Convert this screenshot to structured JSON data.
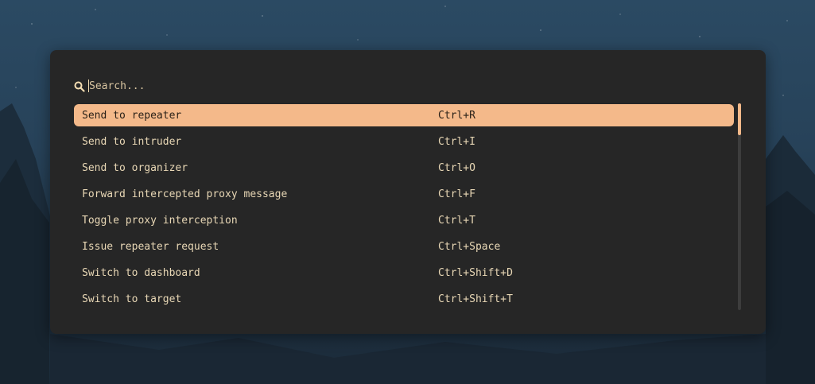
{
  "search": {
    "placeholder": "Search..."
  },
  "commands": [
    {
      "label": "Send to repeater",
      "shortcut": "Ctrl+R",
      "selected": true
    },
    {
      "label": "Send to intruder",
      "shortcut": "Ctrl+I",
      "selected": false
    },
    {
      "label": "Send to organizer",
      "shortcut": "Ctrl+O",
      "selected": false
    },
    {
      "label": "Forward intercepted proxy message",
      "shortcut": "Ctrl+F",
      "selected": false
    },
    {
      "label": "Toggle proxy interception",
      "shortcut": "Ctrl+T",
      "selected": false
    },
    {
      "label": "Issue repeater request",
      "shortcut": "Ctrl+Space",
      "selected": false
    },
    {
      "label": "Switch to dashboard",
      "shortcut": "Ctrl+Shift+D",
      "selected": false
    },
    {
      "label": "Switch to target",
      "shortcut": "Ctrl+Shift+T",
      "selected": false
    }
  ],
  "colors": {
    "panel": "#262626",
    "accent": "#f4b98a",
    "text": "#e8d7b5"
  },
  "icons": {
    "search": "search-icon"
  }
}
